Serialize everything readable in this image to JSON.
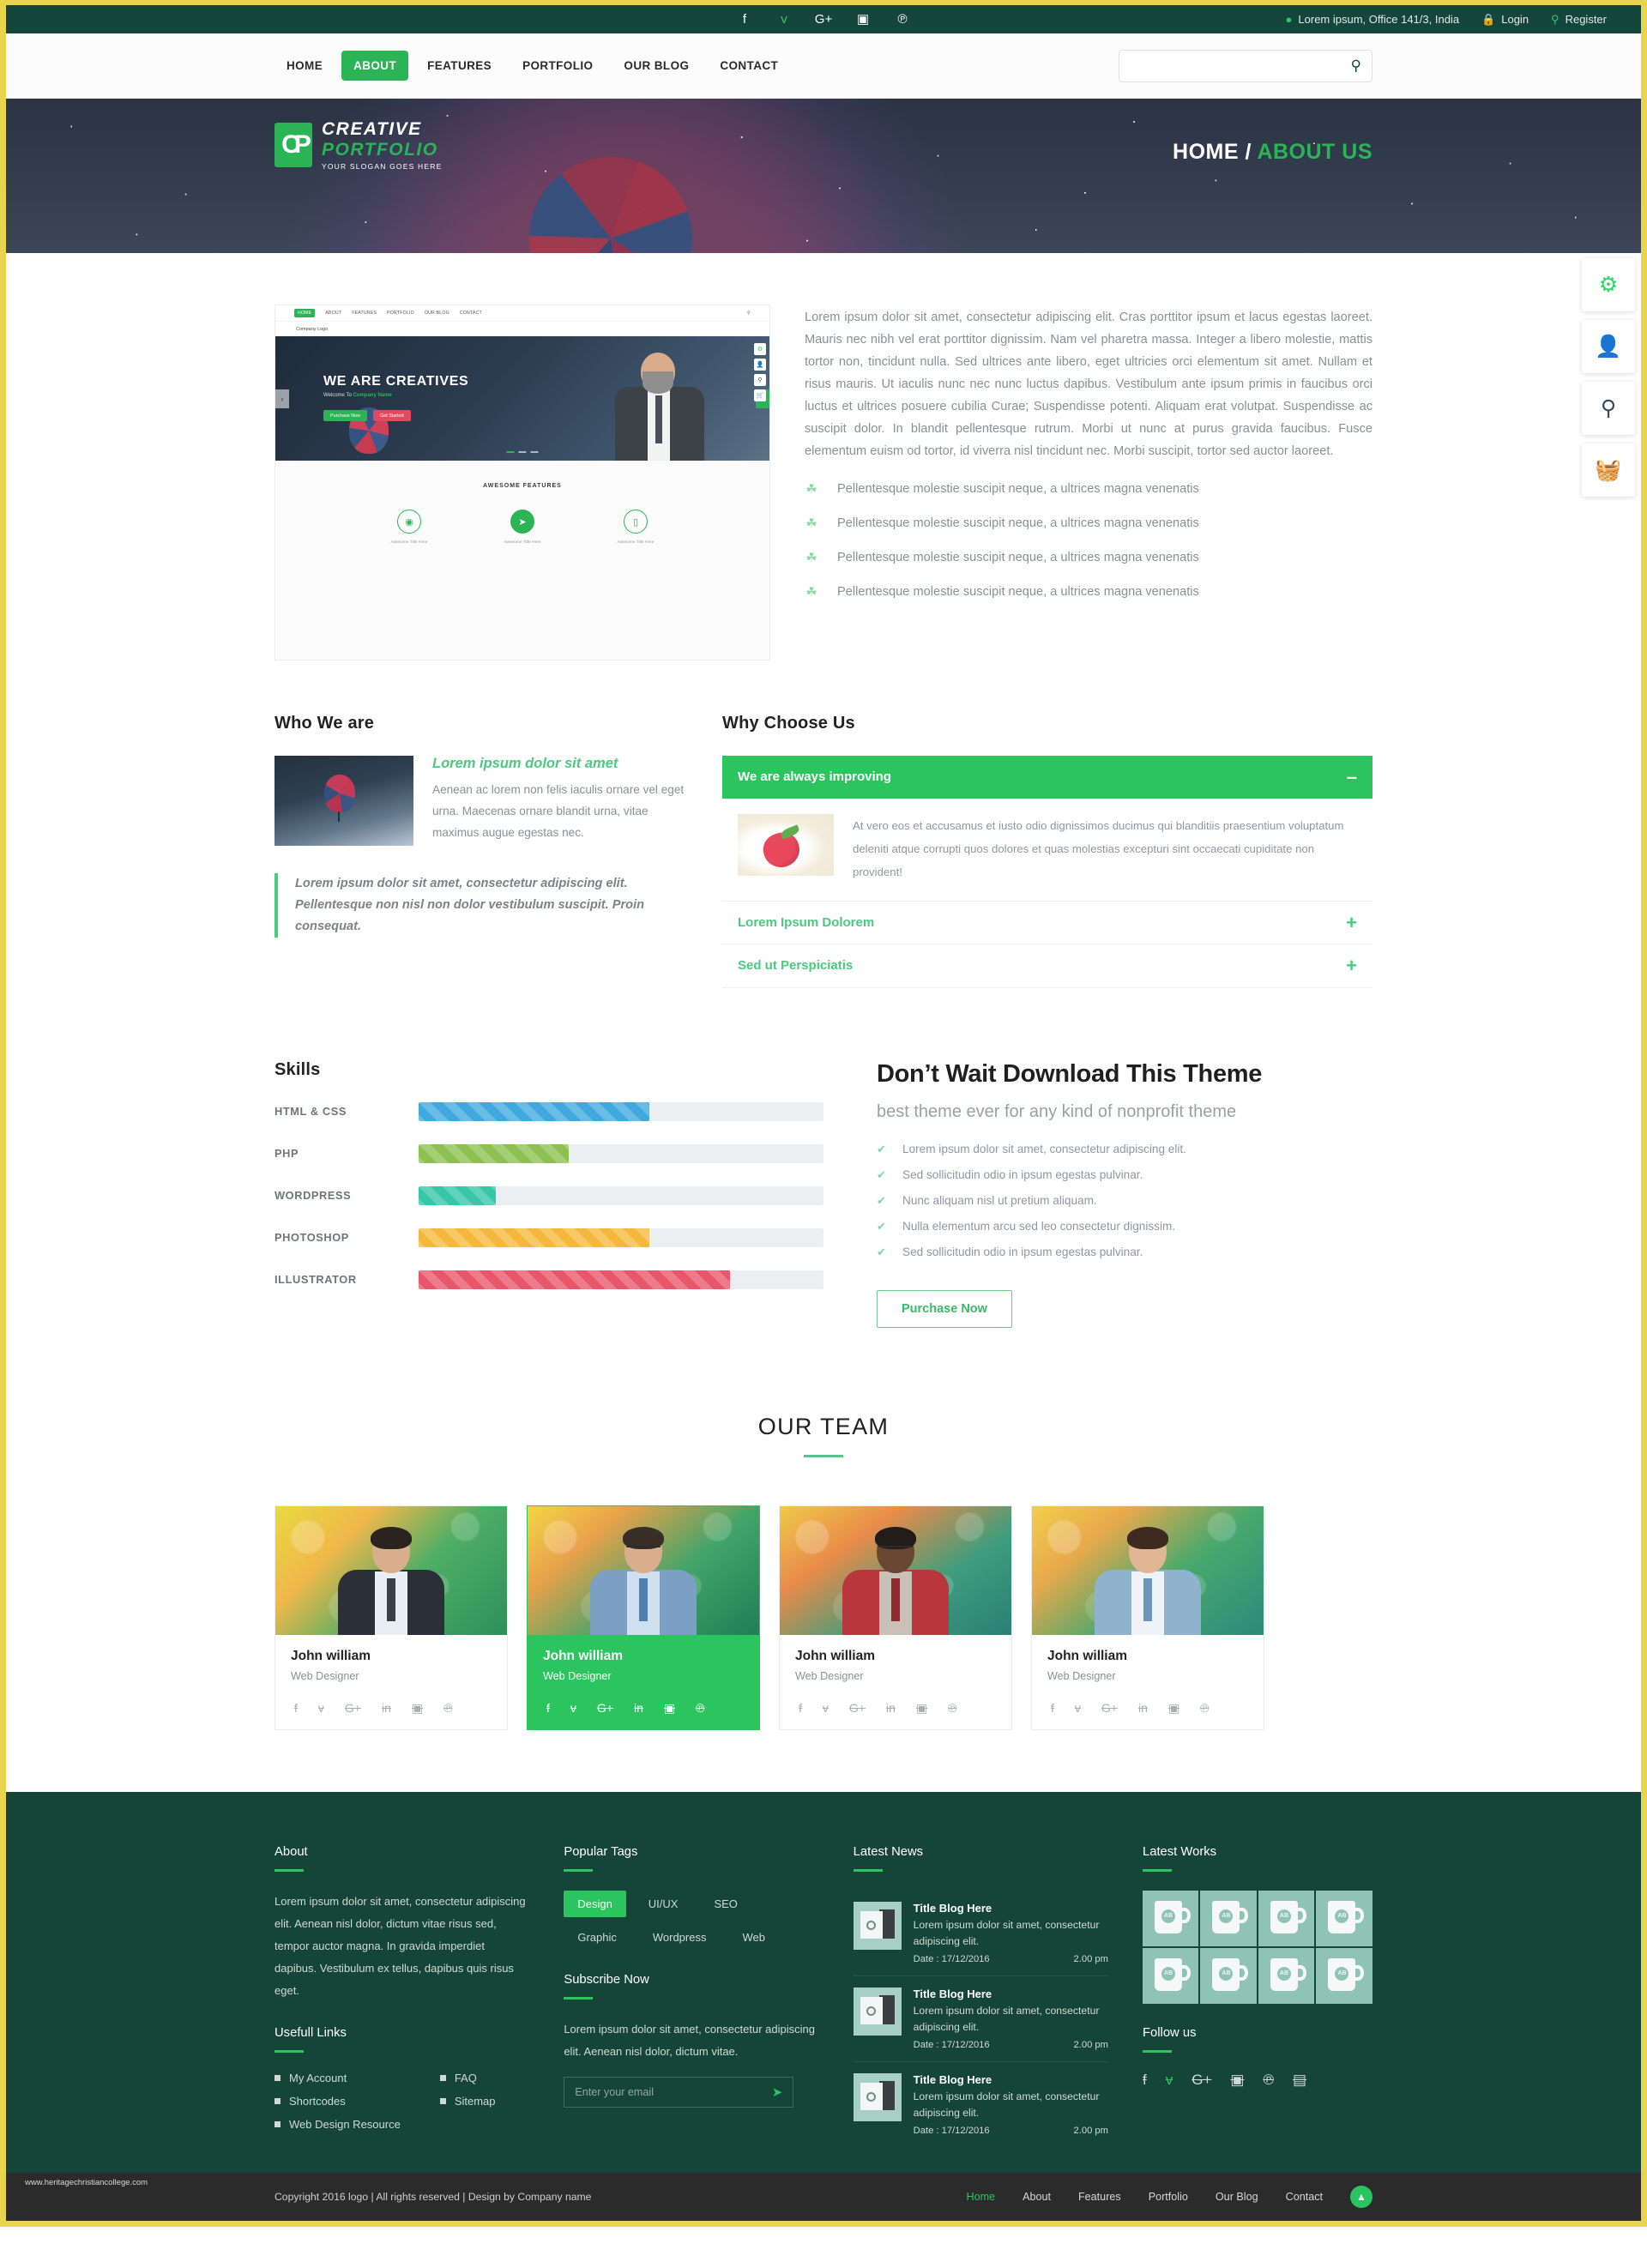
{
  "topbar": {
    "social": [
      {
        "name": "facebook-icon",
        "glyph": "f"
      },
      {
        "name": "twitter-icon",
        "glyph": "ᴠ"
      },
      {
        "name": "google-plus-icon",
        "glyph": "G+"
      },
      {
        "name": "instagram-icon",
        "glyph": "▣"
      },
      {
        "name": "pinterest-icon",
        "glyph": "℗"
      }
    ],
    "address": "Lorem ipsum, Office 141/3, India",
    "login": "Login",
    "register": "Register"
  },
  "nav": {
    "items": [
      {
        "label": "HOME",
        "active": false
      },
      {
        "label": "ABOUT",
        "active": true
      },
      {
        "label": "FEATURES",
        "active": false
      },
      {
        "label": "PORTFOLIO",
        "active": false
      },
      {
        "label": "OUR BLOG",
        "active": false
      },
      {
        "label": "CONTACT",
        "active": false
      }
    ],
    "search_value": "",
    "search_placeholder": ""
  },
  "hero": {
    "logo_line1": "CREATIVE",
    "logo_line2": "PORTFOLIO",
    "logo_slogan": "YOUR SLOGAN GOES HERE",
    "logo_mark": "CP",
    "breadcrumb_home": "HOME",
    "breadcrumb_sep": " / ",
    "breadcrumb_current": "ABOUT US"
  },
  "side_icons": [
    {
      "name": "gear-icon",
      "glyph": "⚙"
    },
    {
      "name": "user-icon",
      "glyph": "👤"
    },
    {
      "name": "search-icon",
      "glyph": "⚲"
    },
    {
      "name": "basket-icon",
      "glyph": "🧺"
    }
  ],
  "preview": {
    "nav": [
      "HOME",
      "ABOUT",
      "FEATURES",
      "PORTFOLIO",
      "OUR BLOG",
      "CONTACT"
    ],
    "active_nav": "HOME",
    "logo": "Company Logo",
    "title": "WE ARE CREATIVES",
    "subtitle_pre": "Welcome To ",
    "subtitle_brand": "Company Name",
    "btn1": "Purchase Now",
    "btn2": "Get Started",
    "features_heading": "AWESOME FEATURES",
    "features": [
      {
        "icon": "globe-icon",
        "glyph": "◉",
        "caption": "Awesome Title Here"
      },
      {
        "icon": "paper-plane-icon",
        "glyph": "➤",
        "caption": "Awesome Title Here"
      },
      {
        "icon": "mobile-icon",
        "glyph": "▯",
        "caption": "Awesome Title Here"
      }
    ]
  },
  "intro": {
    "paragraph": "Lorem ipsum dolor sit amet, consectetur adipiscing elit. Cras porttitor ipsum et lacus egestas laoreet. Mauris nec nibh vel erat porttitor dignissim. Nam vel pharetra massa. Integer a libero molestie, mattis tortor non, tincidunt nulla. Sed ultrices ante libero, eget ultricies orci elementum sit amet. Nullam et risus mauris. Ut iaculis nunc nec nunc luctus dapibus. Vestibulum ante ipsum primis in faucibus orci luctus et ultrices posuere cubilia Curae; Suspendisse potenti. Aliquam erat volutpat. Suspendisse ac suscipit dolor. In blandit pellentesque rutrum. Morbi ut nunc at purus gravida faucibus. Fusce elementum euism od tortor, id viverra nisl tincidunt nec. Morbi suscipit, tortor sed auctor laoreet.",
    "bullets": [
      "Pellentesque molestie suscipit neque, a ultrices magna venenatis",
      "Pellentesque molestie suscipit neque, a ultrices magna venenatis",
      "Pellentesque molestie suscipit neque, a ultrices magna venenatis",
      "Pellentesque molestie suscipit neque, a ultrices magna venenatis"
    ]
  },
  "who": {
    "heading": "Who We are",
    "title": "Lorem ipsum dolor sit amet",
    "text": "Aenean ac lorem non felis iaculis ornare vel eget urna. Maecenas ornare blandit urna, vitae maximus augue egestas nec.",
    "quote": "Lorem ipsum dolor sit amet, consectetur adipiscing elit. Pellentesque non nisl non dolor vestibulum suscipit. Proin consequat."
  },
  "why": {
    "heading": "Why Choose Us",
    "items": [
      {
        "title": "We are always improving",
        "open": true,
        "sign": "–",
        "body": "At vero eos et accusamus et iusto odio dignissimos ducimus qui blanditiis praesentium voluptatum deleniti atque corrupti quos dolores et quas molestias excepturi sint occaecati cupiditate non provident!"
      },
      {
        "title": "Lorem Ipsum Dolorem",
        "open": false,
        "sign": "+",
        "body": ""
      },
      {
        "title": "Sed ut Perspiciatis",
        "open": false,
        "sign": "+",
        "body": ""
      }
    ]
  },
  "skills": {
    "heading": "Skills",
    "items": [
      {
        "label": "HTML & CSS",
        "percent": 57,
        "color": "#3fa9dd"
      },
      {
        "label": "PHP",
        "percent": 37,
        "color": "#8cc051"
      },
      {
        "label": "WORDPRESS",
        "percent": 19,
        "color": "#36c6a8"
      },
      {
        "label": "PHOTOSHOP",
        "percent": 57,
        "color": "#f5b83c"
      },
      {
        "label": "ILLUSTRATOR",
        "percent": 77,
        "color": "#e8566a"
      }
    ]
  },
  "download": {
    "heading": "Don’t Wait Download This Theme",
    "subheading": "best theme ever for any kind of nonprofit theme",
    "checks": [
      "Lorem ipsum dolor sit amet, consectetur adipiscing elit.",
      "Sed sollicitudin odio in ipsum egestas pulvinar.",
      "Nunc aliquam nisl ut pretium aliquam.",
      "Nulla elementum arcu sed leo consectetur dignissim.",
      "Sed sollicitudin odio in ipsum egestas pulvinar."
    ],
    "button": "Purchase Now"
  },
  "team": {
    "heading": "OUR TEAM",
    "social_glyphs": [
      "f",
      "ᴠ",
      "G+",
      "in",
      "▣",
      "℗"
    ],
    "members": [
      {
        "name": "John william",
        "role": "Web Designer",
        "selected": false
      },
      {
        "name": "John william",
        "role": "Web Designer",
        "selected": true
      },
      {
        "name": "John william",
        "role": "Web Designer",
        "selected": false
      },
      {
        "name": "John william",
        "role": "Web Designer",
        "selected": false
      }
    ]
  },
  "footer": {
    "about_heading": "About",
    "about_text": "Lorem ipsum dolor sit amet, consectetur adipiscing elit. Aenean nisl dolor, dictum vitae risus sed, tempor auctor magna. In gravida imperdiet dapibus. Vestibulum ex tellus, dapibus quis risus eget.",
    "links_heading": "Usefull Links",
    "links_col1": [
      "My Account",
      "Shortcodes",
      "Web Design Resource"
    ],
    "links_col2": [
      "FAQ",
      "Sitemap"
    ],
    "tags_heading": "Popular Tags",
    "tags": [
      {
        "label": "Design",
        "active": true
      },
      {
        "label": "UI/UX",
        "active": false
      },
      {
        "label": "SEO",
        "active": false
      },
      {
        "label": "Graphic",
        "active": false
      },
      {
        "label": "Wordpress",
        "active": false
      },
      {
        "label": "Web",
        "active": false
      }
    ],
    "subscribe_heading": "Subscribe Now",
    "subscribe_text": "Lorem ipsum dolor sit amet, consectetur adipiscing elit. Aenean nisl dolor, dictum vitae.",
    "subscribe_placeholder": "Enter your email",
    "subscribe_value": "",
    "news_heading": "Latest News",
    "news": [
      {
        "title": "Title Blog Here",
        "excerpt": "Lorem ipsum dolor sit amet, consectetur adipiscing elit.",
        "date": "Date : 17/12/2016",
        "time": "2.00 pm"
      },
      {
        "title": "Title Blog Here",
        "excerpt": "Lorem ipsum dolor sit amet, consectetur adipiscing elit.",
        "date": "Date : 17/12/2016",
        "time": "2.00 pm"
      },
      {
        "title": "Title Blog Here",
        "excerpt": "Lorem ipsum dolor sit amet, consectetur adipiscing elit.",
        "date": "Date : 17/12/2016",
        "time": "2.00 pm"
      }
    ],
    "works_heading": "Latest Works",
    "works_count": 8,
    "follow_heading": "Follow us",
    "follow": [
      {
        "name": "facebook-icon",
        "glyph": "f"
      },
      {
        "name": "twitter-icon",
        "glyph": "ᴠ"
      },
      {
        "name": "google-plus-icon",
        "glyph": "G+"
      },
      {
        "name": "instagram-icon",
        "glyph": "▣"
      },
      {
        "name": "pinterest-icon",
        "glyph": "℗"
      },
      {
        "name": "youtube-icon",
        "glyph": "▤"
      }
    ]
  },
  "bottom": {
    "watermark": "www.heritagechristiancollege.com",
    "copyright": "Copyright 2016 logo  |  All rights reserved  |  Design by Company name",
    "nav": [
      {
        "label": "Home",
        "active": true
      },
      {
        "label": "About",
        "active": false
      },
      {
        "label": "Features",
        "active": false
      },
      {
        "label": "Portfolio",
        "active": false
      },
      {
        "label": "Our Blog",
        "active": false
      },
      {
        "label": "Contact",
        "active": false
      }
    ],
    "to_top": "▲"
  },
  "colors": {
    "accent_green": "#2bc45e",
    "dark_green": "#14463c",
    "border_yellow": "#e8d44d"
  }
}
